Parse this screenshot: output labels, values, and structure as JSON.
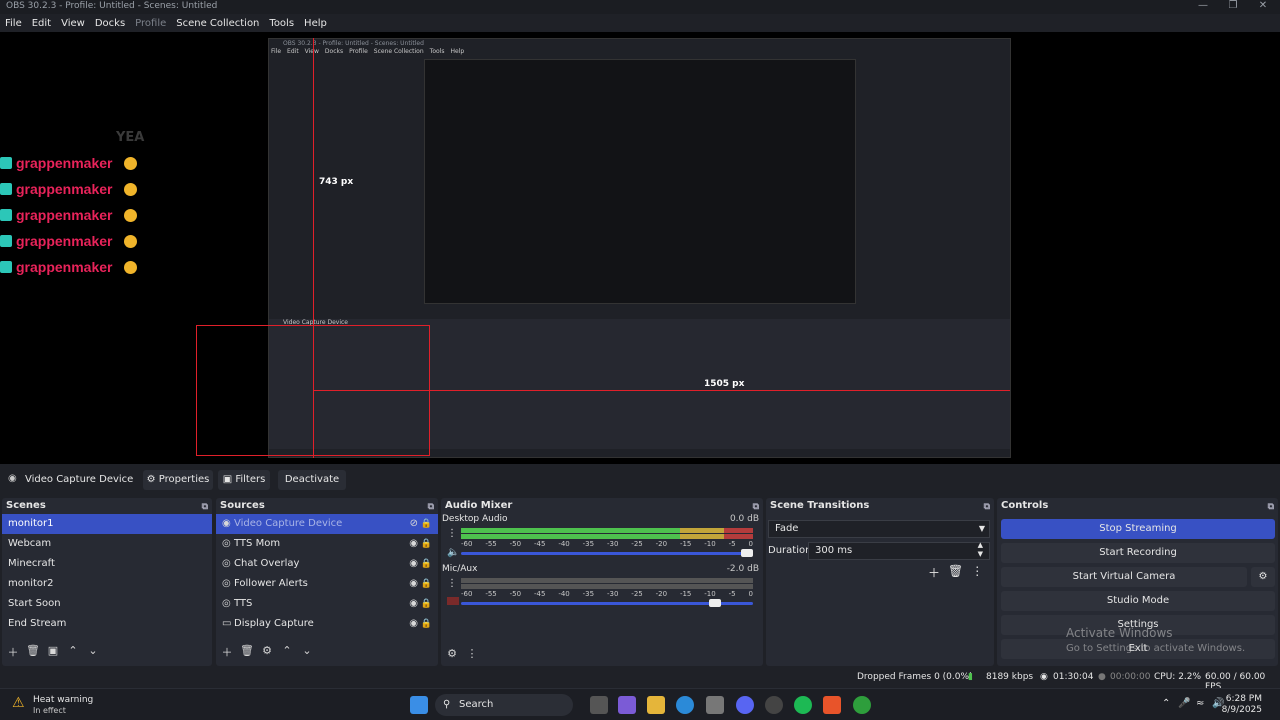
{
  "window": {
    "title": "OBS 30.2.3 - Profile: Untitled - Scenes: Untitled"
  },
  "menu": [
    "File",
    "Edit",
    "View",
    "Docks",
    "Profile",
    "Scene Collection",
    "Tools",
    "Help"
  ],
  "preview": {
    "chat_name": "grappenmaker",
    "ghost_text": "YEA",
    "measure_1": "743 px",
    "measure_2": "1505 px",
    "nested_title": "OBS 30.2.3 - Profile: Untitled - Scenes: Untitled",
    "nested_src_label": "Video Capture Device"
  },
  "source_bar": {
    "source_name": "Video Capture Device",
    "properties_label": "Properties",
    "filters_label": "Filters",
    "deactivate_label": "Deactivate"
  },
  "scenes": {
    "title": "Scenes",
    "items": [
      "monitor1",
      "Webcam",
      "Minecraft",
      "monitor2",
      "Start Soon",
      "End Stream"
    ]
  },
  "sources": {
    "title": "Sources",
    "items": [
      "Video Capture Device",
      "TTS Mom",
      "Chat Overlay",
      "Follower Alerts",
      "TTS",
      "Display Capture"
    ]
  },
  "audio_mixer": {
    "title": "Audio Mixer",
    "channels": [
      {
        "name": "Desktop Audio",
        "db": "0.0 dB",
        "level": 1.0,
        "volume": 0.98
      },
      {
        "name": "Mic/Aux",
        "db": "-2.0 dB",
        "level": 0.0,
        "volume": 0.87
      }
    ],
    "ticks": [
      "-60",
      "-55",
      "-50",
      "-45",
      "-40",
      "-35",
      "-30",
      "-25",
      "-20",
      "-15",
      "-10",
      "-5",
      "0"
    ]
  },
  "scene_transitions": {
    "title": "Scene Transitions",
    "transition": "Fade",
    "duration_label": "Duration",
    "duration_value": "300 ms"
  },
  "controls": {
    "title": "Controls",
    "stop_streaming": "Stop Streaming",
    "start_recording": "Start Recording",
    "start_virtual_camera": "Start Virtual Camera",
    "studio_mode": "Studio Mode",
    "settings": "Settings",
    "exit": "Exit"
  },
  "watermark": {
    "line1": "Activate Windows",
    "line2": "Go to Settings to activate Windows."
  },
  "status": {
    "dropped_frames": "Dropped Frames 0 (0.0%)",
    "bitrate": "8189 kbps",
    "stream_time": "01:30:04",
    "rec_time": "00:00:00",
    "cpu": "CPU: 2.2%",
    "fps": "60.00 / 60.00 FPS"
  },
  "taskbar": {
    "warning_title": "Heat warning",
    "warning_sub": "In effect",
    "search_placeholder": "Search",
    "time": "6:28 PM",
    "date": "8/9/2025"
  },
  "colors": {
    "accent": "#3851c4",
    "chat_name": "#e8235a",
    "measure": "#e0202a"
  }
}
